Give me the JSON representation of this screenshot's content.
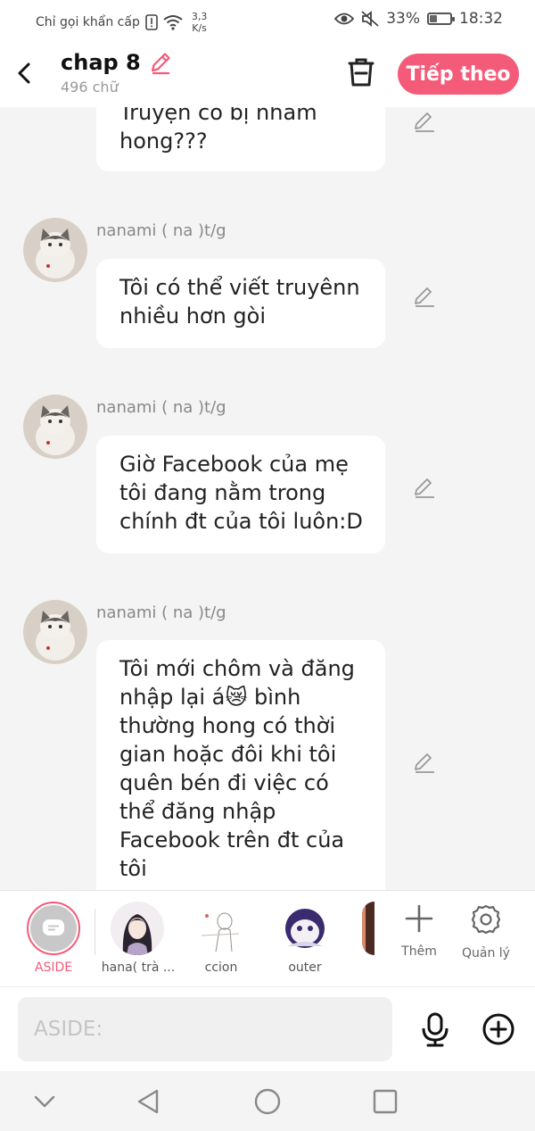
{
  "status_bar": {
    "carrier": "Chỉ gọi khẩn cấp",
    "net_speed_value": "3,3",
    "net_speed_unit": "K/s",
    "battery": "33%",
    "battery_level": 0.33,
    "time": "18:32"
  },
  "header": {
    "title": "chap 8",
    "word_count": "496 chữ",
    "next_label": "Tiếp theo"
  },
  "messages": [
    {
      "text": "Truyện có bị nhám hong???",
      "partial": true
    },
    {
      "author": "nanami ( na )t/g",
      "text": "Tôi có thể viết truyênn nhiều hơn gòi"
    },
    {
      "author": "nanami ( na )t/g",
      "text": "Giờ Facebook của mẹ tôi đang nằm trong chính đt của tôi luôn:D"
    },
    {
      "author": "nanami ( na )t/g",
      "text": "Tôi mới chôm và đăng nhập lại á😿 bình thường hong có thời gian hoặc đôi khi tôi quên bén đi việc có thể đăng nhập Facebook trên đt của tôi"
    }
  ],
  "characters": {
    "aside_label": "ASIDE",
    "items": [
      {
        "label": "hana( trà ..."
      },
      {
        "label": "ccion"
      },
      {
        "label": "outer"
      }
    ],
    "add_label": "Thêm",
    "manage_label": "Quản lý"
  },
  "input": {
    "placeholder": "ASIDE:"
  },
  "colors": {
    "accent": "#f45b79"
  }
}
